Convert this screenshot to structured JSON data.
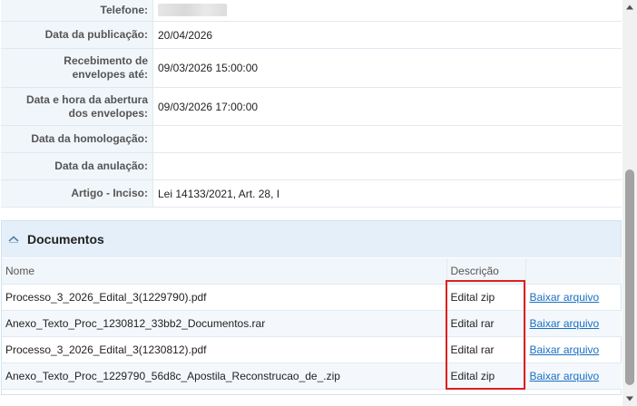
{
  "details": {
    "telefone": {
      "label": "Telefone:",
      "value": ""
    },
    "publicacao": {
      "label": "Data da publicação:",
      "value": "20/04/2026"
    },
    "recebimento": {
      "label_line1": "Recebimento de",
      "label_line2": "envelopes até:",
      "value": "09/03/2026 15:00:00"
    },
    "abertura": {
      "label_line1": "Data e hora da abertura",
      "label_line2": "dos envelopes:",
      "value": "09/03/2026 17:00:00"
    },
    "homologacao": {
      "label": "Data da homologação:",
      "value": ""
    },
    "anulacao": {
      "label": "Data da anulação:",
      "value": ""
    },
    "artigo": {
      "label": "Artigo - Inciso:",
      "value": "Lei 14133/2021, Art. 28, I"
    }
  },
  "documents": {
    "title": "Documentos",
    "headers": {
      "nome": "Nome",
      "descricao": "Descrição",
      "acao": ""
    },
    "rows": [
      {
        "nome": "Processo_3_2026_Edital_3(1229790).pdf",
        "descricao": "Edital zip",
        "link": "Baixar arquivo"
      },
      {
        "nome": "Anexo_Texto_Proc_1230812_33bb2_Documentos.rar",
        "descricao": "Edital rar",
        "link": "Baixar arquivo"
      },
      {
        "nome": "Processo_3_2026_Edital_3(1230812).pdf",
        "descricao": "Edital rar",
        "link": "Baixar arquivo"
      },
      {
        "nome": "Anexo_Texto_Proc_1229790_56d8c_Apostila_Reconstrucao_de_.zip",
        "descricao": "Edital zip",
        "link": "Baixar arquivo"
      }
    ]
  },
  "colors": {
    "link": "#1a6fc2",
    "highlight": "#e01e1e",
    "header_bg": "#e4eff9",
    "label_bg": "#f1f6fb"
  },
  "icons": {
    "collapse": "chevron-up-icon",
    "scroll_up": "triangle-up-icon",
    "scroll_down": "triangle-down-icon"
  }
}
